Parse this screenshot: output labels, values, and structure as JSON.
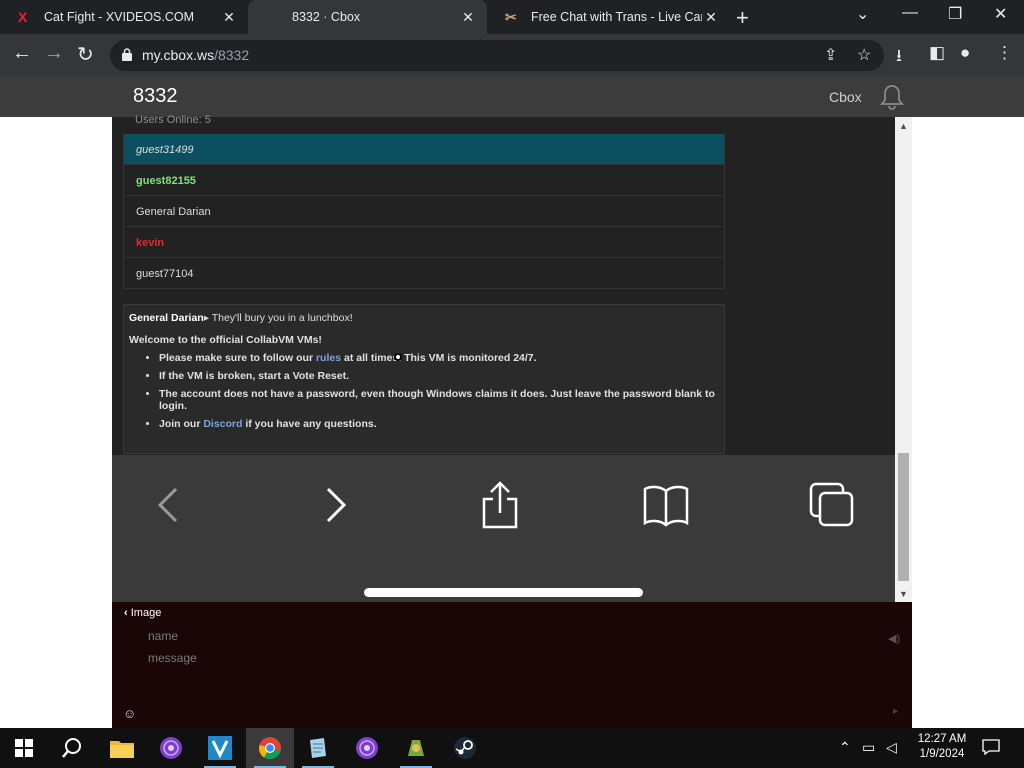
{
  "browser": {
    "tabs": [
      {
        "title": "Cat Fight - XVIDEOS.COM",
        "favicon": "X",
        "active": false
      },
      {
        "title": "8332 · Cbox",
        "favicon": "",
        "active": true
      },
      {
        "title": "Free Chat with Trans - Live Cam",
        "favicon": "✂",
        "active": false
      }
    ],
    "url_host": "my.cbox.ws",
    "url_path": "/8332"
  },
  "cbox": {
    "title": "8332",
    "brand": "Cbox",
    "users_online": "Users Online: 5",
    "users": [
      {
        "name": "guest31499",
        "style": "selected"
      },
      {
        "name": "guest82155",
        "style": "green"
      },
      {
        "name": "General Darian",
        "style": "normal"
      },
      {
        "name": "kevin",
        "style": "red"
      },
      {
        "name": "guest77104",
        "style": "normal"
      }
    ],
    "chat": {
      "nick": "General Darian",
      "message": "They'll bury you in a lunchbox!",
      "motd": "Welcome to the official CollabVM VMs!",
      "rules_pre": "Please make sure to follow our ",
      "rules_link": "rules",
      "rules_post": " at all times. This VM is monitored 24/7.",
      "rule2": "If the VM is broken, start a Vote Reset.",
      "rule3": "The account does not have a password, even though Windows claims it does. Just leave the password blank to login.",
      "discord_pre": "Join our ",
      "discord_link": "Discord",
      "discord_post": " if you have any questions."
    },
    "image_label": "Image",
    "name_placeholder": "name",
    "message_placeholder": "message"
  },
  "taskbar": {
    "time": "12:27 AM",
    "date": "1/9/2024"
  },
  "colors": {
    "accent": "#76b9ed",
    "selected_user": "#0c4f60",
    "green_user": "#7fe27f",
    "red_user": "#e8282c",
    "link": "#7aa3e0"
  }
}
